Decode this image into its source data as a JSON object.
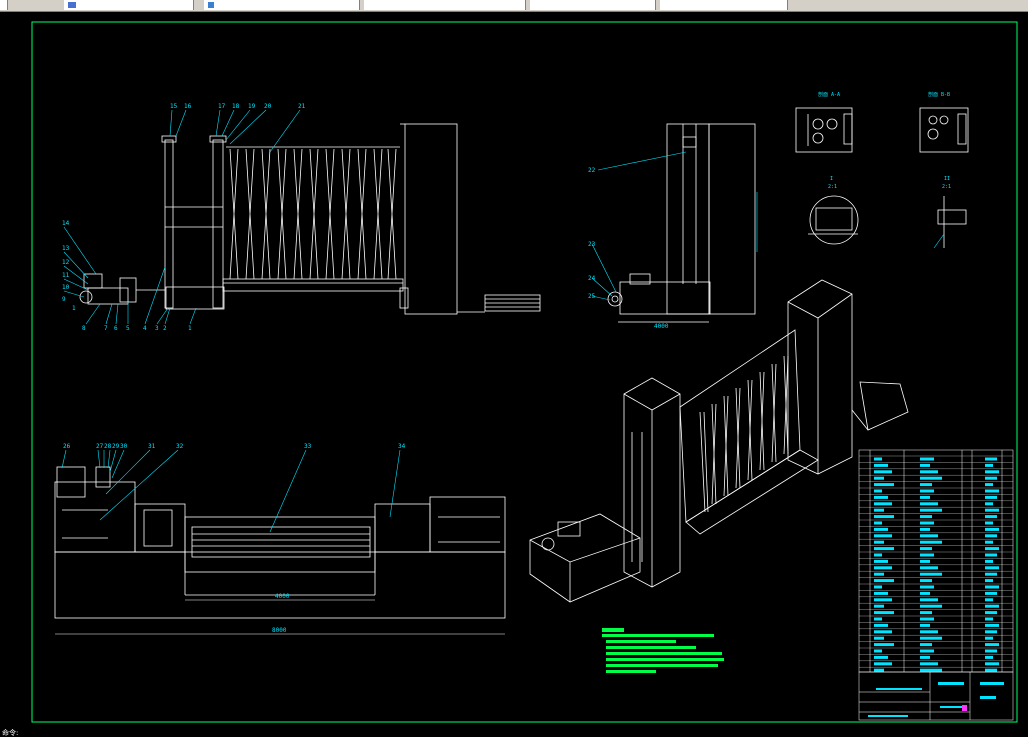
{
  "toolbar": {
    "tabs": [
      "",
      "",
      "",
      "",
      "",
      ""
    ],
    "accent": "#d4d0c8"
  },
  "drawing": {
    "background": "#000000",
    "frame_color": "#00ff66",
    "line_color": "#ffffff",
    "dim_color": "#00e5ff",
    "note_color": "#00ff44",
    "section_a_label": "剖面 A-A",
    "section_b_label": "剖面 B-B",
    "detail_1_label": "I",
    "detail_1_scale": "2:1",
    "detail_2_label": "II",
    "detail_2_scale": "2:1",
    "front_view_callouts": [
      "15",
      "16",
      "17",
      "18",
      "19",
      "20",
      "21",
      "14",
      "13",
      "12",
      "11",
      "10",
      "9",
      "1",
      "8",
      "7",
      "6",
      "5",
      "4",
      "3",
      "2",
      "1"
    ],
    "side_view_callouts": [
      "22",
      "23",
      "24",
      "25"
    ],
    "plan_view_callouts": [
      "26",
      "27",
      "28",
      "29",
      "30",
      "31",
      "32",
      "33",
      "34"
    ],
    "side_dim": "4000",
    "plan_dim_inner": "4000",
    "plan_dim_total": "8000"
  },
  "statusbar": {
    "text": "命令:"
  }
}
